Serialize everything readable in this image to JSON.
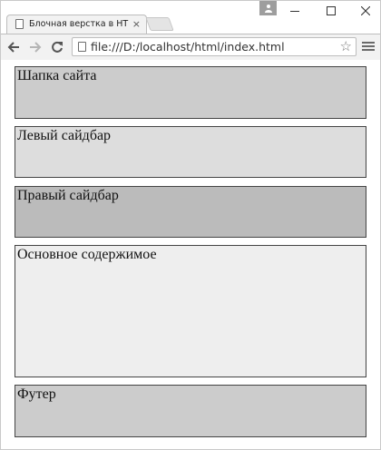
{
  "browser": {
    "tab": {
      "title": "Блочная верстка в HTML",
      "close_glyph": "×"
    },
    "address_bar": {
      "url": "file:///D:/localhost/html/index.html"
    },
    "icons": {
      "back": "back-arrow-icon",
      "forward": "forward-arrow-icon",
      "reload": "reload-icon",
      "star": "bookmark-star-icon",
      "menu": "hamburger-menu-icon",
      "profile": "profile-icon"
    }
  },
  "page": {
    "header": "Шапка сайта",
    "left_sidebar": "Левый сайдбар",
    "right_sidebar": "Правый сайдбар",
    "main": "Основное содержимое",
    "footer": "Футер"
  },
  "colors": {
    "header_bg": "#cccccc",
    "left_sidebar_bg": "#dddddd",
    "right_sidebar_bg": "#bbbbbb",
    "main_bg": "#eeeeee",
    "footer_bg": "#cccccc"
  }
}
